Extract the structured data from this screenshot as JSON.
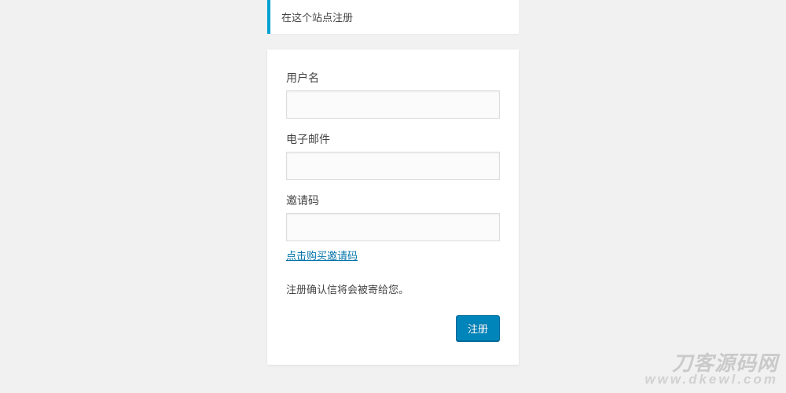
{
  "banner": {
    "text": "在这个站点注册"
  },
  "form": {
    "username": {
      "label": "用户名",
      "value": ""
    },
    "email": {
      "label": "电子邮件",
      "value": ""
    },
    "invite": {
      "label": "邀请码",
      "value": "",
      "link_text": "点击购买邀请码"
    },
    "confirm_text": "注册确认信将会被寄给您。",
    "submit_label": "注册"
  },
  "watermark": {
    "line1": "刀客源码网",
    "line2": "www.dkewl.com"
  }
}
